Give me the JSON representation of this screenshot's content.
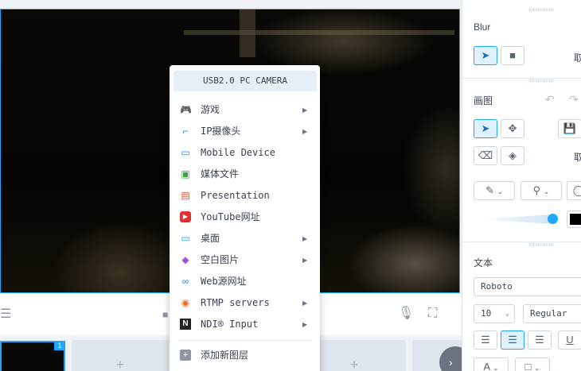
{
  "source_menu": {
    "header": "USB2.0 PC CAMERA",
    "items": [
      {
        "label": "游戏",
        "icon": "gamepad-icon",
        "color": "#f4a41b",
        "glyph": "🎮",
        "submenu": true
      },
      {
        "label": "IP摄像头",
        "icon": "ip-camera-icon",
        "color": "#2a86d6",
        "glyph": "⌐",
        "submenu": true
      },
      {
        "label": "Mobile Device",
        "icon": "mobile-device-icon",
        "color": "#2a86d6",
        "glyph": "▭",
        "submenu": false
      },
      {
        "label": "媒体文件",
        "icon": "media-file-icon",
        "color": "#3aa13a",
        "glyph": "▣",
        "submenu": false
      },
      {
        "label": "Presentation",
        "icon": "presentation-icon",
        "color": "#e0502f",
        "glyph": "▤",
        "submenu": false
      },
      {
        "label": "YouTube网址",
        "icon": "youtube-icon",
        "color": "#e03232",
        "glyph": "▶",
        "submenu": false
      },
      {
        "label": "桌面",
        "icon": "desktop-icon",
        "color": "#1e9be8",
        "glyph": "▭",
        "submenu": true
      },
      {
        "label": "空白图片",
        "icon": "blank-image-icon",
        "color": "#9b59d6",
        "glyph": "◆",
        "submenu": true
      },
      {
        "label": "Web源网址",
        "icon": "link-icon",
        "color": "#2a86d6",
        "glyph": "∞",
        "submenu": false
      },
      {
        "label": "RTMP servers",
        "icon": "rtmp-icon",
        "color": "#f26b21",
        "glyph": "◉",
        "submenu": true
      },
      {
        "label": "NDI® Input",
        "icon": "ndi-icon",
        "color": "#222222",
        "glyph": "N",
        "submenu": true
      }
    ],
    "footer": {
      "label": "添加新图层",
      "icon": "add-layer-icon",
      "glyph": "+"
    }
  },
  "panel": {
    "blur_title": "Blur",
    "draw_title": "画图",
    "text_title": "文本",
    "cancel_label_1": "取",
    "cancel_label_2": "取",
    "font_name": "Roboto",
    "font_size": "10",
    "font_weight": "Regular",
    "underline": "U",
    "text_style": "A"
  },
  "scenes": {
    "active_badge": "1",
    "add_glyph": "+"
  },
  "colors": {
    "accent": "#1ea7fd",
    "stroke_color": "#000000"
  }
}
